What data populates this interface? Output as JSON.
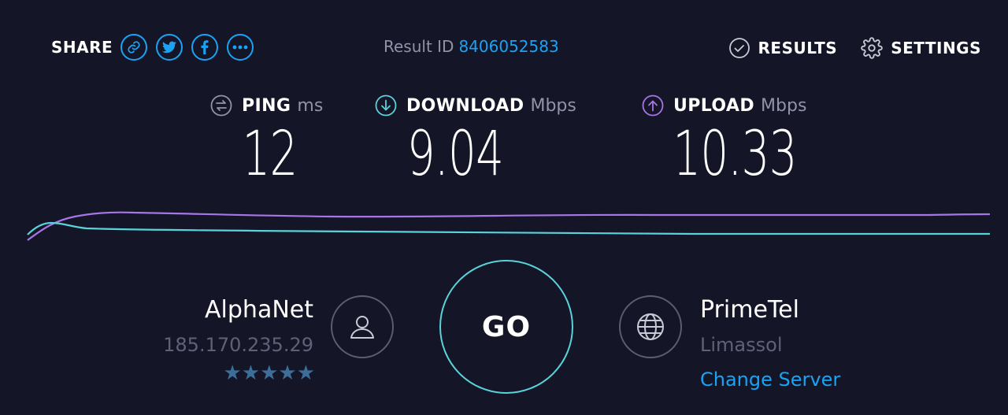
{
  "header": {
    "share_label": "SHARE",
    "share_icons": [
      "link-icon",
      "twitter-icon",
      "facebook-icon",
      "more-icon"
    ],
    "result_label": "Result ID",
    "result_id": "8406052583",
    "results_label": "RESULTS",
    "settings_label": "SETTINGS"
  },
  "metrics": {
    "ping": {
      "label": "PING",
      "unit": "ms",
      "value": "12",
      "icon": "ping-icon"
    },
    "download": {
      "label": "DOWNLOAD",
      "unit": "Mbps",
      "value": "9.04",
      "icon": "download-icon"
    },
    "upload": {
      "label": "UPLOAD",
      "unit": "Mbps",
      "value": "10.33",
      "icon": "upload-icon"
    }
  },
  "isp": {
    "name": "AlphaNet",
    "ip": "185.170.235.29",
    "rating": 5,
    "stars": "★★★★★"
  },
  "go_label": "GO",
  "server": {
    "name": "PrimeTel",
    "location": "Limassol",
    "change_label": "Change Server"
  },
  "colors": {
    "background": "#141526",
    "accent_blue": "#1aa3f5",
    "download_teal": "#5ad2db",
    "upload_purple": "#a775e6",
    "muted_text": "#9193a8"
  }
}
